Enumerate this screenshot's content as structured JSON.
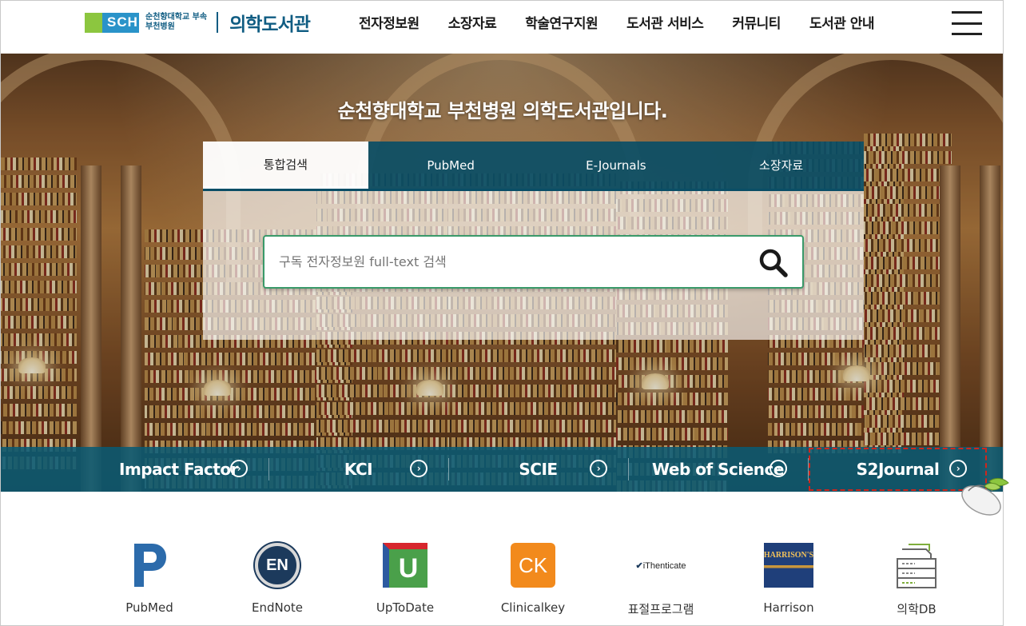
{
  "header": {
    "logo_badge": "SCH",
    "logo_sub_line1": "순천향대학교 부속",
    "logo_sub_line2": "부천병원",
    "logo_title": "의학도서관",
    "nav": [
      "전자정보원",
      "소장자료",
      "학술연구지원",
      "도서관 서비스",
      "커뮤니티",
      "도서관 안내"
    ]
  },
  "hero": {
    "title": "순천향대학교 부천병원 의학도서관입니다."
  },
  "search": {
    "tabs": [
      {
        "label": "통합검색",
        "active": true
      },
      {
        "label": "PubMed",
        "active": false
      },
      {
        "label": "E-Journals",
        "active": false
      },
      {
        "label": "소장자료",
        "active": false
      }
    ],
    "placeholder": "구독 전자정보원 full-text 검색"
  },
  "quicklinks": [
    {
      "label": "Impact Factor"
    },
    {
      "label": "KCI"
    },
    {
      "label": "SCIE"
    },
    {
      "label": "Web of Science"
    },
    {
      "label": "S2Journal",
      "highlighted": true
    }
  ],
  "icons": [
    {
      "label": "PubMed",
      "icon": "pubmed-icon"
    },
    {
      "label": "EndNote",
      "icon": "endnote-icon",
      "text": "EN"
    },
    {
      "label": "UpToDate",
      "icon": "uptodate-icon",
      "text": "U"
    },
    {
      "label": "Clinicalkey",
      "icon": "clinicalkey-icon",
      "text": "CK"
    },
    {
      "label": "표절프로그램",
      "icon": "ithenticate-icon",
      "text": "iThenticate"
    },
    {
      "label": "Harrison",
      "icon": "harrison-icon",
      "text": "HARRISON'S"
    },
    {
      "label": "의학DB",
      "icon": "database-icon"
    }
  ],
  "colors": {
    "brand": "#0f5c82",
    "tab_bg": "#0a4e66",
    "quickbar": "#0a5a73",
    "search_border": "#3a9a6a",
    "highlight": "#d0261c"
  }
}
